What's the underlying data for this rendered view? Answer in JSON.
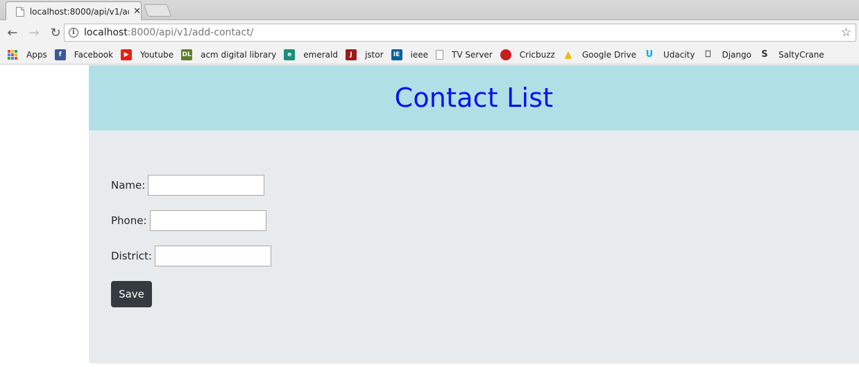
{
  "browser": {
    "tab": {
      "title": "localhost:8000/api/v1/add-contact/"
    },
    "address": {
      "host": "localhost",
      "rest": ":8000/api/v1/add-contact/"
    },
    "bookmarks": [
      {
        "label": "Apps",
        "icon": "apps-grid-icon"
      },
      {
        "label": "Facebook",
        "icon": "facebook-icon",
        "color": "#3b5998",
        "glyph": "f"
      },
      {
        "label": "Youtube",
        "icon": "youtube-icon",
        "color": "#e62117",
        "glyph": "▶"
      },
      {
        "label": "acm digital library",
        "icon": "acm-dl-icon",
        "color": "#5c7f2a",
        "glyph": "DL"
      },
      {
        "label": "emerald",
        "icon": "emerald-icon",
        "color": "#1a8f7a",
        "glyph": "e"
      },
      {
        "label": "jstor",
        "icon": "jstor-icon",
        "color": "#9b1b1b",
        "glyph": "J"
      },
      {
        "label": "ieee",
        "icon": "ieee-icon",
        "color": "#00629b",
        "glyph": "IE"
      },
      {
        "label": "TV Server",
        "icon": "page-icon",
        "color": "#ffffff",
        "glyph": ""
      },
      {
        "label": "Cricbuzz",
        "icon": "cricbuzz-icon",
        "color": "#c81e1e",
        "glyph": "●"
      },
      {
        "label": "Google Drive",
        "icon": "google-drive-icon",
        "color": "#f4b400",
        "glyph": "▲"
      },
      {
        "label": "Udacity",
        "icon": "udacity-icon",
        "color": "#02b3e4",
        "glyph": "U"
      },
      {
        "label": "Django",
        "icon": "book-icon",
        "color": "#444444",
        "glyph": "⎕"
      },
      {
        "label": "SaltyCrane",
        "icon": "saltycrane-icon",
        "color": "#333333",
        "glyph": "S"
      }
    ]
  },
  "page": {
    "title": "Contact List",
    "form": {
      "name_label": "Name:",
      "phone_label": "Phone:",
      "district_label": "District:",
      "name_value": "",
      "phone_value": "",
      "district_value": "",
      "save_label": "Save"
    }
  },
  "colors": {
    "header_bg": "#b0dfe5",
    "title_color": "#0b10f0",
    "page_bg": "#e8ebee",
    "button_bg": "#343a40"
  }
}
